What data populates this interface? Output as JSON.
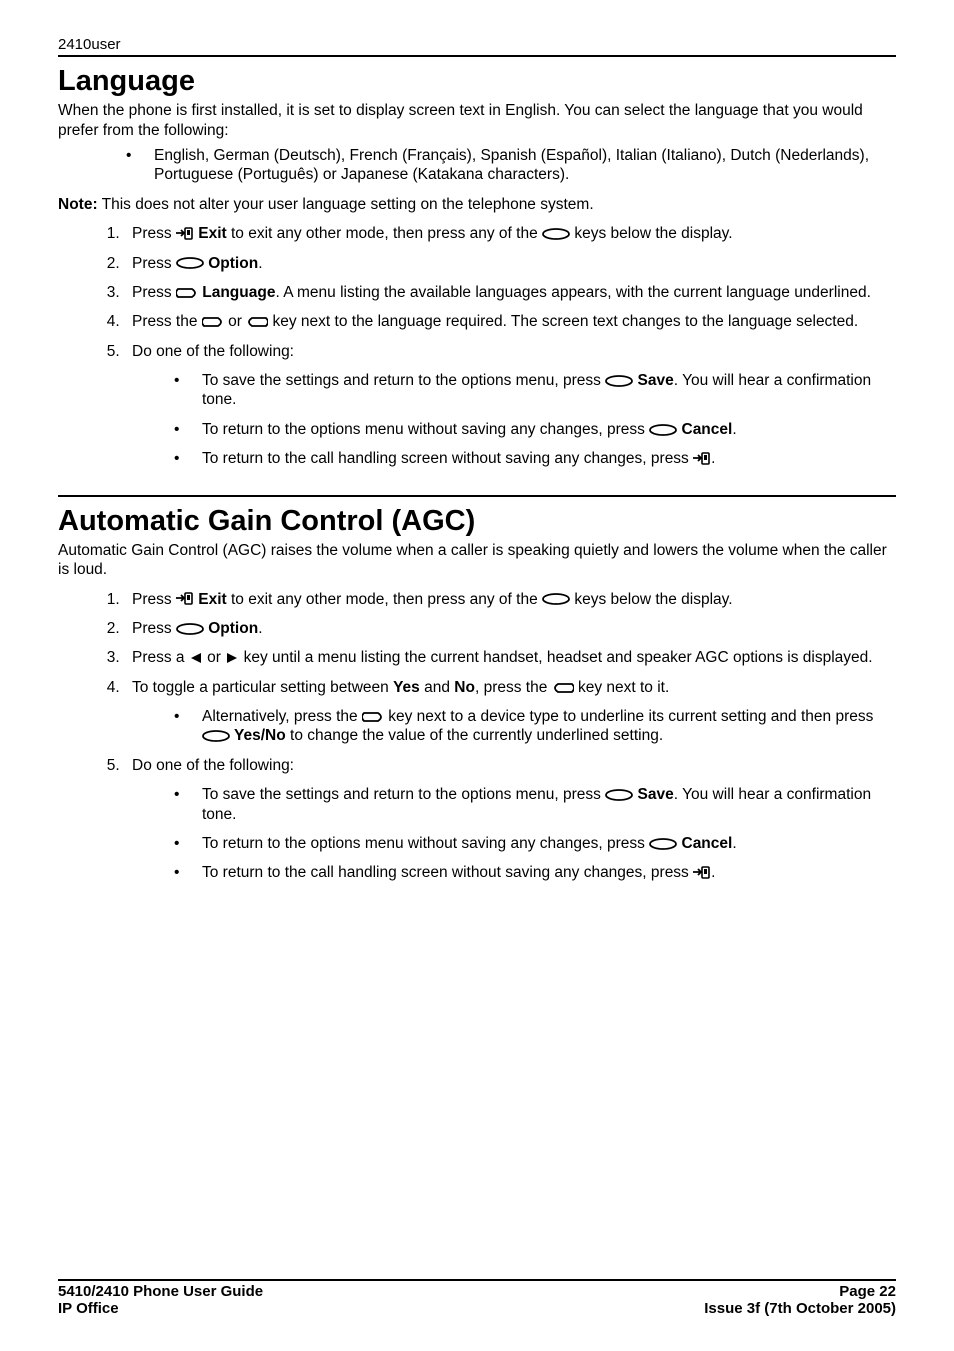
{
  "header": "2410user",
  "section1": {
    "title": "Language",
    "intro": "When the phone is first installed, it is set to display screen text in English. You can select the language that you would prefer from the following:",
    "lang_bullet": "English, German (Deutsch), French (Français), Spanish (Español), Italian (Italiano), Dutch (Nederlands), Portuguese (Português) or Japanese (Katakana characters).",
    "note_label": "Note:",
    "note_text": " This does not alter your user language setting on the telephone system.",
    "steps": {
      "s1a": "Press ",
      "s1_exit": " Exit",
      "s1b": " to exit any other mode, then press any of the ",
      "s1c": " keys below the display.",
      "s2a": "Press ",
      "s2_option": " Option",
      "s2b": ".",
      "s3a": "Press ",
      "s3_language": " Language",
      "s3b": ". A menu listing the available languages appears, with the current language underlined.",
      "s4a": "Press the ",
      "s4b": " or ",
      "s4c": " key next to the language required. The screen text changes to the language selected.",
      "s5": "Do one of the following:",
      "s5_b1a": "To save the settings and return to the options menu, press ",
      "s5_b1_save": " Save",
      "s5_b1b": ". You will hear a confirmation tone.",
      "s5_b2a": "To return to the options menu without saving any changes, press ",
      "s5_b2_cancel": " Cancel",
      "s5_b2b": ".",
      "s5_b3a": "To return to the call handling screen without saving any changes, press ",
      "s5_b3b": "."
    }
  },
  "section2": {
    "title": "Automatic Gain Control (AGC)",
    "intro": "Automatic Gain Control (AGC) raises the volume when a caller is speaking quietly and lowers the volume when the caller is loud.",
    "steps": {
      "s1a": "Press ",
      "s1_exit": " Exit",
      "s1b": " to exit any other mode, then press any of the ",
      "s1c": " keys below the display.",
      "s2a": "Press ",
      "s2_option": " Option",
      "s2b": ".",
      "s3a": "Press a ",
      "s3b": " or ",
      "s3c": " key until a menu listing the current handset, headset and speaker AGC options is displayed.",
      "s4a": "To toggle a particular setting between ",
      "s4_yes": "Yes",
      "s4b": " and ",
      "s4_no": "No",
      "s4c": ", press the ",
      "s4d": " key next to it.",
      "s4_sub_a": "Alternatively, press the ",
      "s4_sub_b": " key next to a device type to underline its current setting and then press ",
      "s4_sub_yesno": " Yes/No",
      "s4_sub_c": " to change the value of the currently underlined setting.",
      "s5": "Do one of the following:",
      "s5_b1a": "To save the settings and return to the options menu, press ",
      "s5_b1_save": " Save",
      "s5_b1b": ". You will hear a confirmation tone.",
      "s5_b2a": "To return to the options menu without saving any changes, press ",
      "s5_b2_cancel": " Cancel",
      "s5_b2b": ".",
      "s5_b3a": "To return to the call handling screen without saving any changes, press ",
      "s5_b3b": "."
    }
  },
  "footer": {
    "left1": "5410/2410 Phone User Guide",
    "left2": "IP Office",
    "right1": "Page 22",
    "right2": "Issue 3f (7th October 2005)"
  }
}
